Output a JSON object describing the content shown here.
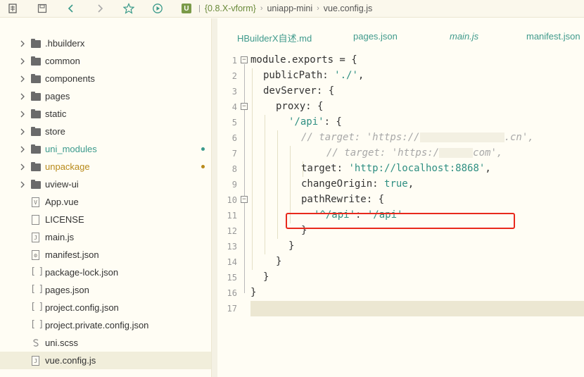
{
  "toolbar": {
    "icons": [
      "new-file-icon",
      "save-icon",
      "back-icon",
      "forward-icon",
      "star-icon",
      "run-icon"
    ],
    "breadcrumb": {
      "logo": "U",
      "branch": "{0.8.X-vform}",
      "project": "uniapp-mini",
      "file": "vue.config.js"
    }
  },
  "sidebar": {
    "items": [
      {
        "label": ".hbuilderx",
        "type": "folder"
      },
      {
        "label": "common",
        "type": "folder"
      },
      {
        "label": "components",
        "type": "folder"
      },
      {
        "label": "pages",
        "type": "folder"
      },
      {
        "label": "static",
        "type": "folder"
      },
      {
        "label": "store",
        "type": "folder"
      },
      {
        "label": "uni_modules",
        "type": "folder",
        "status": "green"
      },
      {
        "label": "unpackage",
        "type": "folder",
        "status": "gold"
      },
      {
        "label": "uview-ui",
        "type": "folder"
      },
      {
        "label": "App.vue",
        "type": "vue"
      },
      {
        "label": "LICENSE",
        "type": "file"
      },
      {
        "label": "main.js",
        "type": "js"
      },
      {
        "label": "manifest.json",
        "type": "manifest"
      },
      {
        "label": "package-lock.json",
        "type": "json"
      },
      {
        "label": "pages.json",
        "type": "json"
      },
      {
        "label": "project.config.json",
        "type": "json"
      },
      {
        "label": "project.private.config.json",
        "type": "json"
      },
      {
        "label": "uni.scss",
        "type": "scss"
      },
      {
        "label": "vue.config.js",
        "type": "js",
        "selected": true
      }
    ],
    "colors": {
      "green": "#3b9a8c",
      "gold": "#b88a1a"
    }
  },
  "tabs": [
    {
      "label": "HBuilderX自述.md",
      "italic": false
    },
    {
      "label": "pages.json",
      "italic": false
    },
    {
      "label": "main.js",
      "italic": true
    },
    {
      "label": "manifest.json",
      "italic": false
    }
  ],
  "code": {
    "line_numbers": [
      "1",
      "2",
      "3",
      "4",
      "5",
      "6",
      "7",
      "8",
      "9",
      "10",
      "11",
      "12",
      "13",
      "14",
      "15",
      "16",
      "17"
    ],
    "l1_a": "module.exports = {",
    "l2_key": "publicPath",
    "l2_colon": ": ",
    "l2_val": "'./'",
    "l2_end": ",",
    "l3_key": "devServer",
    "l3_end": ": {",
    "l4_key": "proxy",
    "l4_end": ": {",
    "l5_key": "'/api'",
    "l5_end": ": {",
    "l6_a": "// target: 'https://",
    "l6_b": ".cn',",
    "l7_a": "// target: 'https:/",
    "l7_b": "com',",
    "l8_key": "target",
    "l8_colon": ": ",
    "l8_val": "'http://localhost:8868'",
    "l8_end": ",",
    "l9_key": "changeOrigin",
    "l9_colon": ": ",
    "l9_val": "true",
    "l9_end": ",",
    "l10_key": "pathRewrite",
    "l10_end": ": {",
    "l11_key": "'^/api'",
    "l11_colon": ": ",
    "l11_val": "'/api'",
    "l12": "}",
    "l13": "}",
    "l14": "}",
    "l15": "}",
    "l16": "}"
  }
}
